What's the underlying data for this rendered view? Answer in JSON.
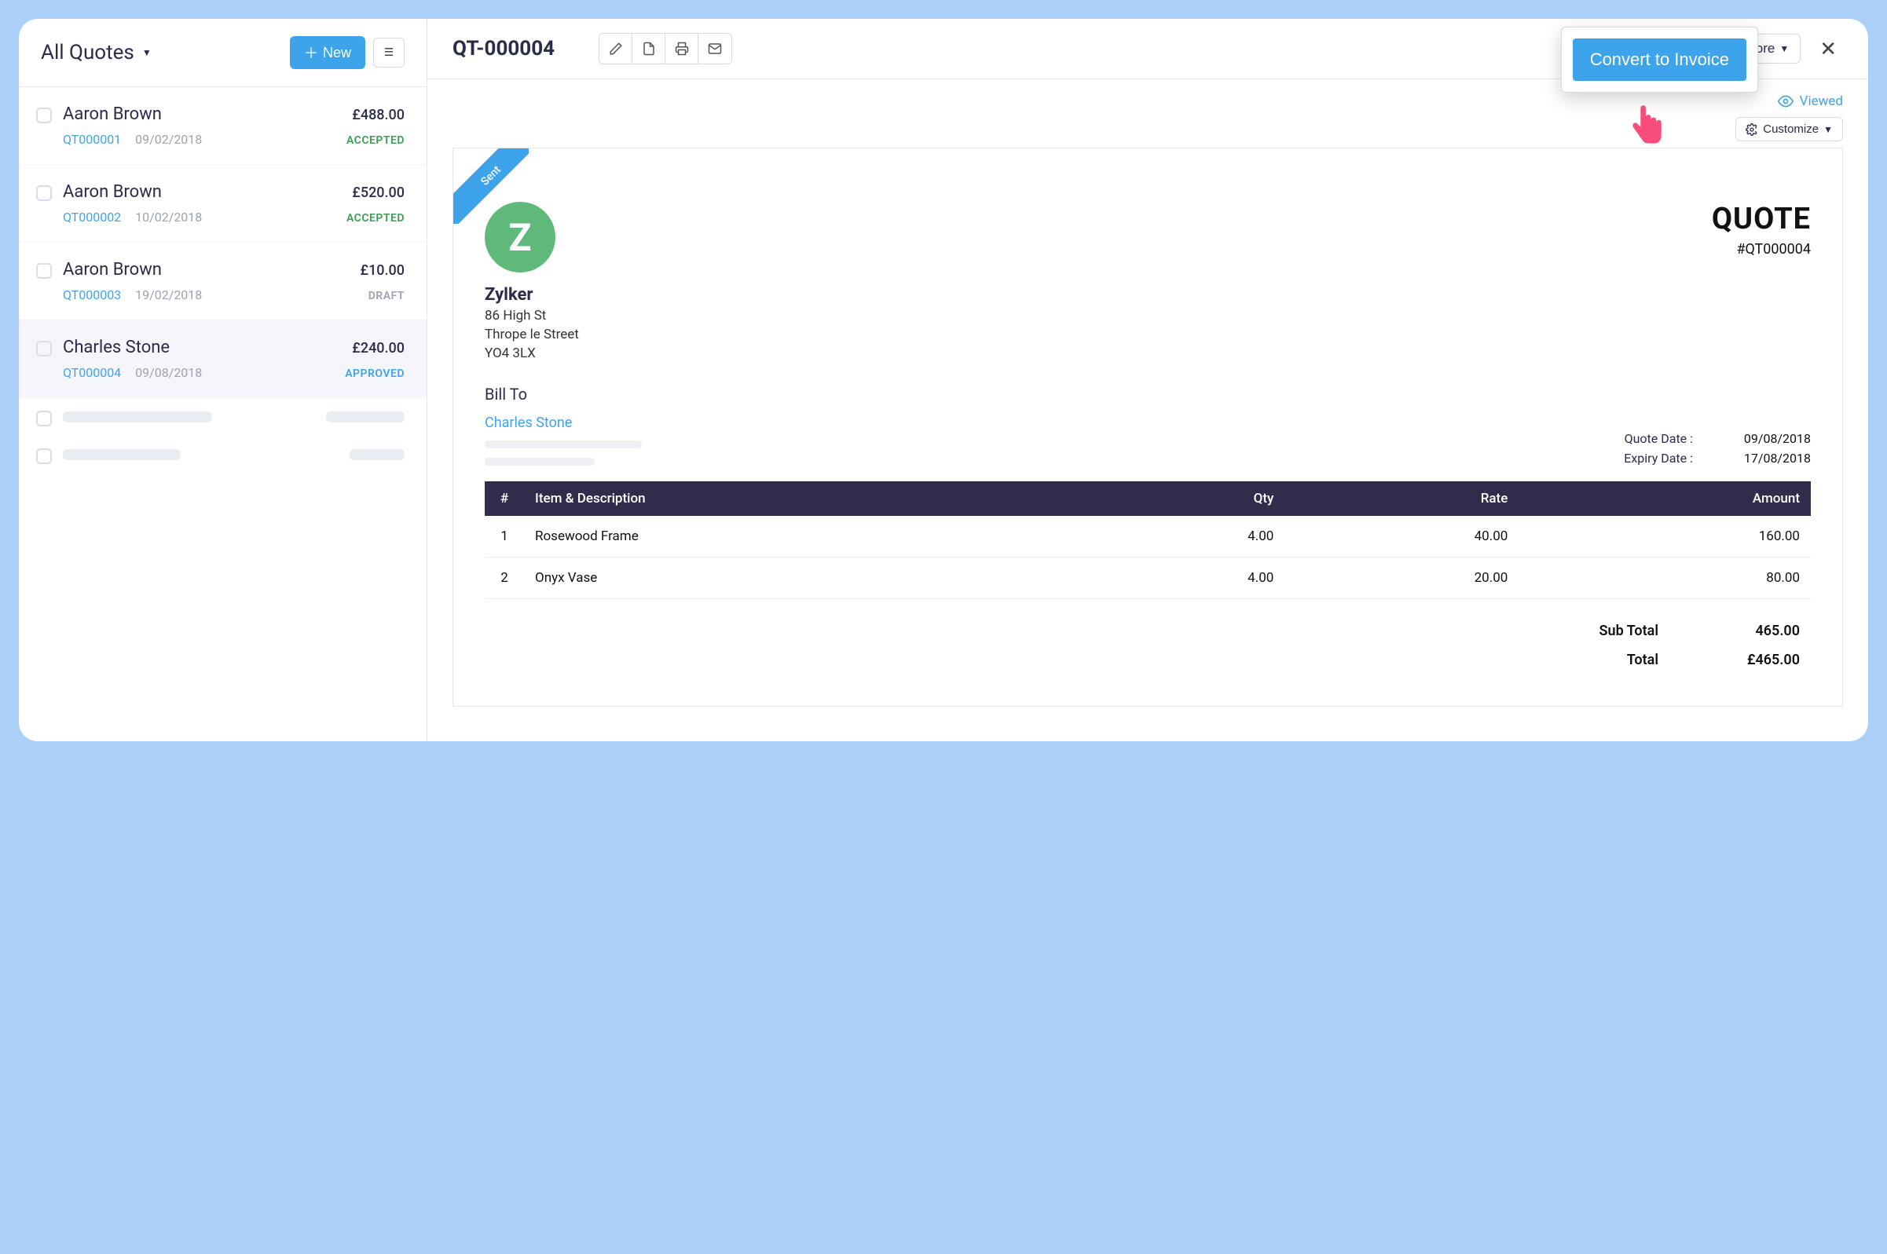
{
  "left": {
    "filter_label": "All Quotes",
    "new_label": "New"
  },
  "quotes": [
    {
      "name": "Aaron Brown",
      "amount": "£488.00",
      "ref": "QT000001",
      "date": "09/02/2018",
      "status": "ACCEPTED",
      "status_class": "st-accepted"
    },
    {
      "name": "Aaron Brown",
      "amount": "£520.00",
      "ref": "QT000002",
      "date": "10/02/2018",
      "status": "ACCEPTED",
      "status_class": "st-accepted"
    },
    {
      "name": "Aaron Brown",
      "amount": "£10.00",
      "ref": "QT000003",
      "date": "19/02/2018",
      "status": "DRAFT",
      "status_class": "st-draft"
    },
    {
      "name": "Charles Stone",
      "amount": "£240.00",
      "ref": "QT000004",
      "date": "09/08/2018",
      "status": "APPROVED",
      "status_class": "st-approved",
      "selected": true
    }
  ],
  "detail": {
    "header_title": "QT-000004",
    "convert_label": "Convert to Invoice",
    "more_label": "More",
    "viewed_label": "Viewed",
    "customize_label": "Customize",
    "ribbon": "Sent",
    "company": {
      "name": "Zylker",
      "addr1": "86 High St",
      "addr2": "Thrope le Street",
      "addr3": "YO4 3LX"
    },
    "doc_label": "QUOTE",
    "doc_number": "#QT000004",
    "bill_to_label": "Bill To",
    "bill_to_name": "Charles Stone",
    "quote_date_label": "Quote Date :",
    "quote_date": "09/08/2018",
    "expiry_date_label": "Expiry Date :",
    "expiry_date": "17/08/2018",
    "cols": {
      "num": "#",
      "desc": "Item & Description",
      "qty": "Qty",
      "rate": "Rate",
      "amount": "Amount"
    },
    "items": [
      {
        "n": "1",
        "desc": "Rosewood Frame",
        "qty": "4.00",
        "rate": "40.00",
        "amount": "160.00"
      },
      {
        "n": "2",
        "desc": "Onyx Vase",
        "qty": "4.00",
        "rate": "20.00",
        "amount": "80.00"
      }
    ],
    "subtotal_label": "Sub Total",
    "subtotal": "465.00",
    "total_label": "Total",
    "total": "£465.00"
  }
}
